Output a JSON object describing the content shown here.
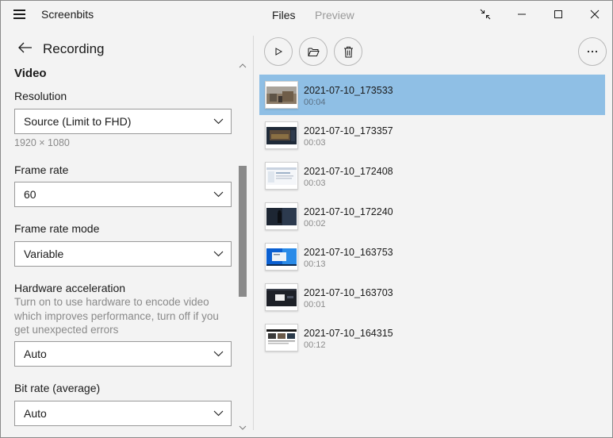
{
  "app": {
    "title": "Screenbits",
    "tabs": [
      {
        "label": "Files",
        "active": true
      },
      {
        "label": "Preview",
        "active": false
      }
    ]
  },
  "settings": {
    "page_title": "Recording",
    "section": "Video",
    "resolution": {
      "label": "Resolution",
      "value": "Source (Limit to FHD)",
      "hint": "1920 × 1080"
    },
    "frame_rate": {
      "label": "Frame rate",
      "value": "60"
    },
    "frame_rate_mode": {
      "label": "Frame rate mode",
      "value": "Variable"
    },
    "hw_accel": {
      "label": "Hardware acceleration",
      "description": "Turn on to use hardware to encode video which improves performance, turn off if you get unexpected errors",
      "value": "Auto"
    },
    "bit_rate": {
      "label": "Bit rate (average)",
      "value": "Auto"
    }
  },
  "toolbar": {
    "icons": [
      "play-icon",
      "folder-icon",
      "delete-icon",
      "more-icon"
    ]
  },
  "files": [
    {
      "name": "2021-07-10_173533",
      "duration": "00:04",
      "selected": true,
      "thumb": "game-scene"
    },
    {
      "name": "2021-07-10_173357",
      "duration": "00:03",
      "selected": false,
      "thumb": "game-menu"
    },
    {
      "name": "2021-07-10_172408",
      "duration": "00:03",
      "selected": false,
      "thumb": "document"
    },
    {
      "name": "2021-07-10_172240",
      "duration": "00:02",
      "selected": false,
      "thumb": "dark-scene"
    },
    {
      "name": "2021-07-10_163753",
      "duration": "00:13",
      "selected": false,
      "thumb": "desktop"
    },
    {
      "name": "2021-07-10_163703",
      "duration": "00:01",
      "selected": false,
      "thumb": "dark-app"
    },
    {
      "name": "2021-07-10_164315",
      "duration": "00:12",
      "selected": false,
      "thumb": "web-page"
    }
  ],
  "colors": {
    "selection": "#8fbfe5",
    "background": "#f3f3f3",
    "scroll_thumb": "#8a8a8a"
  }
}
